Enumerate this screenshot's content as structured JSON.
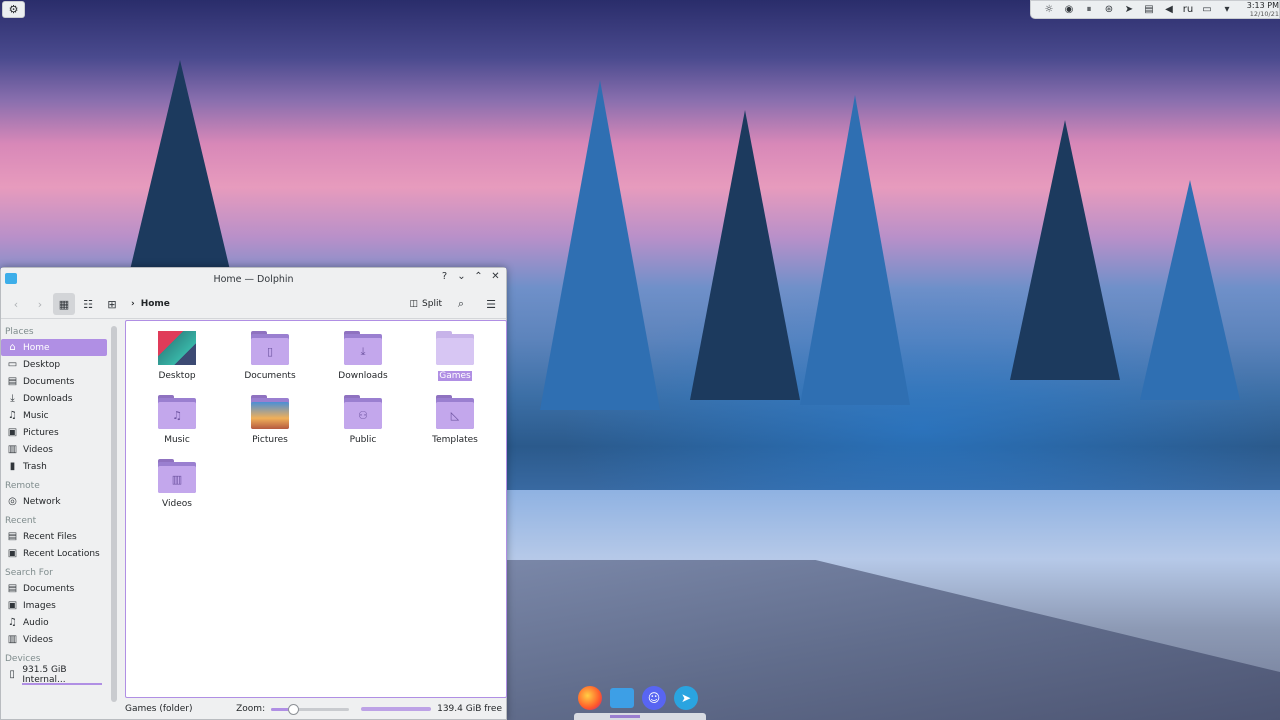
{
  "window": {
    "title": "Home — Dolphin",
    "controls": [
      "?",
      "⌄",
      "⌃",
      "✕"
    ]
  },
  "toolbar": {
    "breadcrumb": "Home",
    "split_label": "Split"
  },
  "sidebar": {
    "places_header": "Places",
    "places": [
      {
        "label": "Home",
        "icon": "home-icon"
      },
      {
        "label": "Desktop",
        "icon": "desktop-icon"
      },
      {
        "label": "Documents",
        "icon": "documents-icon"
      },
      {
        "label": "Downloads",
        "icon": "downloads-icon"
      },
      {
        "label": "Music",
        "icon": "music-icon"
      },
      {
        "label": "Pictures",
        "icon": "pictures-icon"
      },
      {
        "label": "Videos",
        "icon": "videos-icon"
      },
      {
        "label": "Trash",
        "icon": "trash-icon"
      }
    ],
    "remote_header": "Remote",
    "remote": [
      {
        "label": "Network",
        "icon": "network-icon"
      }
    ],
    "recent_header": "Recent",
    "recent": [
      {
        "label": "Recent Files",
        "icon": "recent-files-icon"
      },
      {
        "label": "Recent Locations",
        "icon": "recent-locations-icon"
      }
    ],
    "search_header": "Search For",
    "search": [
      {
        "label": "Documents",
        "icon": "documents-icon"
      },
      {
        "label": "Images",
        "icon": "images-icon"
      },
      {
        "label": "Audio",
        "icon": "audio-icon"
      },
      {
        "label": "Videos",
        "icon": "videos-icon"
      }
    ],
    "devices_header": "Devices",
    "devices": [
      {
        "label": "931.5 GiB Internal...",
        "icon": "drive-icon"
      }
    ]
  },
  "files": [
    {
      "name": "Desktop",
      "kind": "desktop"
    },
    {
      "name": "Documents",
      "kind": "documents"
    },
    {
      "name": "Downloads",
      "kind": "downloads"
    },
    {
      "name": "Games",
      "kind": "games",
      "selected": true
    },
    {
      "name": "Music",
      "kind": "music"
    },
    {
      "name": "Pictures",
      "kind": "pictures"
    },
    {
      "name": "Public",
      "kind": "public"
    },
    {
      "name": "Templates",
      "kind": "templates"
    },
    {
      "name": "Videos",
      "kind": "videos"
    }
  ],
  "status": {
    "selection": "Games (folder)",
    "zoom_label": "Zoom:",
    "zoom_level": 0.28,
    "free_space": "139.4 GiB free"
  },
  "tray": {
    "language": "ru",
    "time": "3:13 PM",
    "date": "12/10/21"
  },
  "dock": [
    "firefox-icon",
    "files-icon",
    "discord-icon",
    "telegram-icon"
  ],
  "colors": {
    "accent": "#b08fe4",
    "folder": "#c3a7ec"
  }
}
